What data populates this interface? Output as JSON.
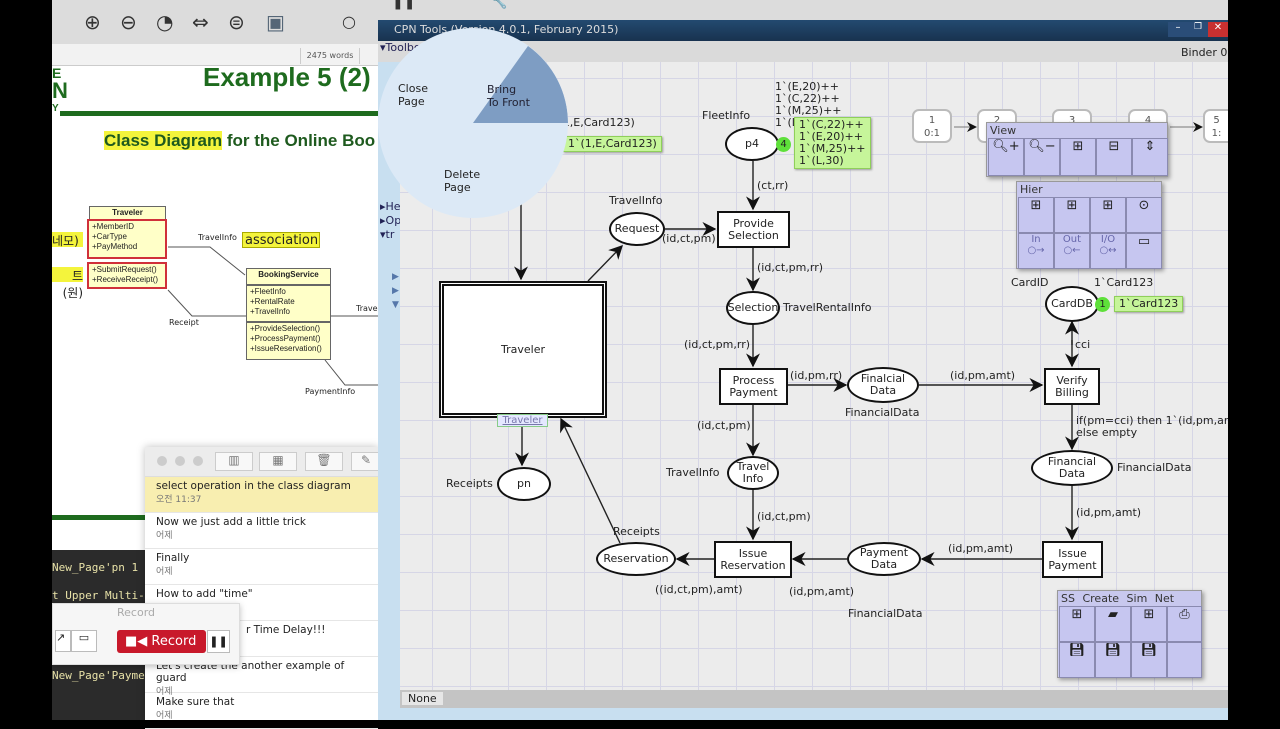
{
  "pdf_viewer": {
    "word_count": "2475 words",
    "title": "Example 5 (2)",
    "subtitle_highlight": "Class Diagram",
    "subtitle_rest": " for the Online Boo",
    "logo_letters": [
      "E",
      "N",
      "Y"
    ],
    "class_traveler": {
      "name": "Traveler",
      "attributes": [
        "+MemberID",
        "+CarType",
        "+PayMethod"
      ],
      "operations": [
        "+SubmitRequest()",
        "+ReceiveReceipt()"
      ]
    },
    "class_booking": {
      "name": "BookingService",
      "attributes": [
        "+FleetInfo",
        "+RentalRate",
        "+TravelInfo"
      ],
      "operations": [
        "+ProvideSelection()",
        "+ProcessPayment()",
        "+IssueReservation()"
      ]
    },
    "annotations": {
      "left1": "네모)",
      "left2": "트 (원)",
      "association": "association"
    },
    "edge_labels": {
      "travelinfo": "TravelInfo",
      "receipt": "Receipt",
      "trave": "Trave",
      "paymentinfo": "PaymentInfo"
    }
  },
  "terminal": {
    "lines": [
      "New_Page'pn 1",
      "t Upper Multi-s",
      "New_Page'Paymen"
    ]
  },
  "notes": {
    "items": [
      {
        "title": "select operation in the class diagram",
        "date": "오전 11:37",
        "selected": true
      },
      {
        "title": "Now we just add a little trick",
        "date": "어제"
      },
      {
        "title": "Finally",
        "date": "어제"
      },
      {
        "title": "How to add \"time\"",
        "date": ""
      },
      {
        "title": "r Time Delay!!!",
        "date": ""
      },
      {
        "title": "Let's create the another example of guard",
        "date": "어제"
      },
      {
        "title": "Make sure that",
        "date": "어제"
      }
    ]
  },
  "record_window": {
    "title": "Record",
    "record_label": "Record",
    "record_color": "#c8192b"
  },
  "cpn": {
    "window_title": "CPN Tools (Version 4.0.1, February 2015)",
    "binder": "Binder 0",
    "index": {
      "toolbox": "Toolbox",
      "items": [
        "He",
        "Op",
        "tr"
      ]
    },
    "pie_menu": {
      "close": "Close\nPage",
      "front": "Bring\nTo Front",
      "delete": "Delete\nPage"
    },
    "status": "None",
    "pages": [
      {
        "n": "1",
        "s": "0:1"
      },
      {
        "n": "2",
        "s": ""
      },
      {
        "n": "3",
        "s": ""
      },
      {
        "n": "4",
        "s": ""
      },
      {
        "n": "5",
        "s": "1:"
      }
    ],
    "palettes": {
      "view": "View",
      "hier": "Hier",
      "hier_cells": [
        "In",
        "Out",
        "I/O"
      ],
      "bottom_tabs": [
        "SS",
        "Create",
        "Sim",
        "Net"
      ]
    },
    "places": {
      "request": "Request",
      "p4": "p4",
      "selection": "Selection",
      "finalcial": "Finalcial\nData",
      "carddb": "CardDB",
      "financial": "Financial\nData",
      "payment": "Payment\nData",
      "travelinfo": "Travel\nInfo",
      "reservation": "Reservation",
      "pn": "pn"
    },
    "transitions": {
      "provide": "Provide\nSelection",
      "process": "Process\nPayment",
      "verify": "Verify\nBilling",
      "issue_payment": "Issue\nPayment",
      "issue_res": "Issue\nReservation",
      "traveler": "Traveler",
      "traveler_tag": "Traveler"
    },
    "labels": {
      "init_top": "1`(1,E,Card123)",
      "fleetinfo": "FleetInfo",
      "fleet_init": "1`(E,20)++\n1`(C,22)++\n1`(M,25)++\n1`(L,30)",
      "ctrr": "(ct,rr)",
      "travelinfo_type": "TravelInfo",
      "idctpm1": "(id,ct,pm)",
      "idctpmrr1": "(id,ct,pm,rr)",
      "travelrental": "TravelRentalInfo",
      "idctpmrr2": "(id,ct,pm,rr)",
      "idpmrr": "(id,pm,rr)",
      "idpmamt1": "(id,pm,amt)",
      "financialdata1": "FinancialData",
      "cardid": "CardID",
      "card_init": "1`Card123",
      "cci": "cci",
      "guard": "if(pm=cci) then 1`(id,pm,am\nelse empty",
      "financialdata2": "FinancialData",
      "idctpm2": "(id,ct,pm)",
      "travelinfo2": "TravelInfo",
      "idpmamt2": "(id,pm,amt)",
      "idctpm3": "(id,ct,pm)",
      "idpmamt3": "(id,pm,amt)",
      "idpmamt4": "(id,pm,amt)",
      "idctpmamt": "((id,ct,pm),amt)",
      "financialdata3": "FinancialData",
      "receipts1": "Receipts",
      "receipts2": "Receipts"
    },
    "markings": {
      "traveler": {
        "count": "1",
        "text": "1`(1,E,Card123)"
      },
      "p4": {
        "count": "4",
        "text": "1`(C,22)++\n1`(E,20)++\n1`(M,25)++\n1`(L,30)"
      },
      "carddb": {
        "count": "1",
        "text": "1`Card123"
      }
    }
  }
}
